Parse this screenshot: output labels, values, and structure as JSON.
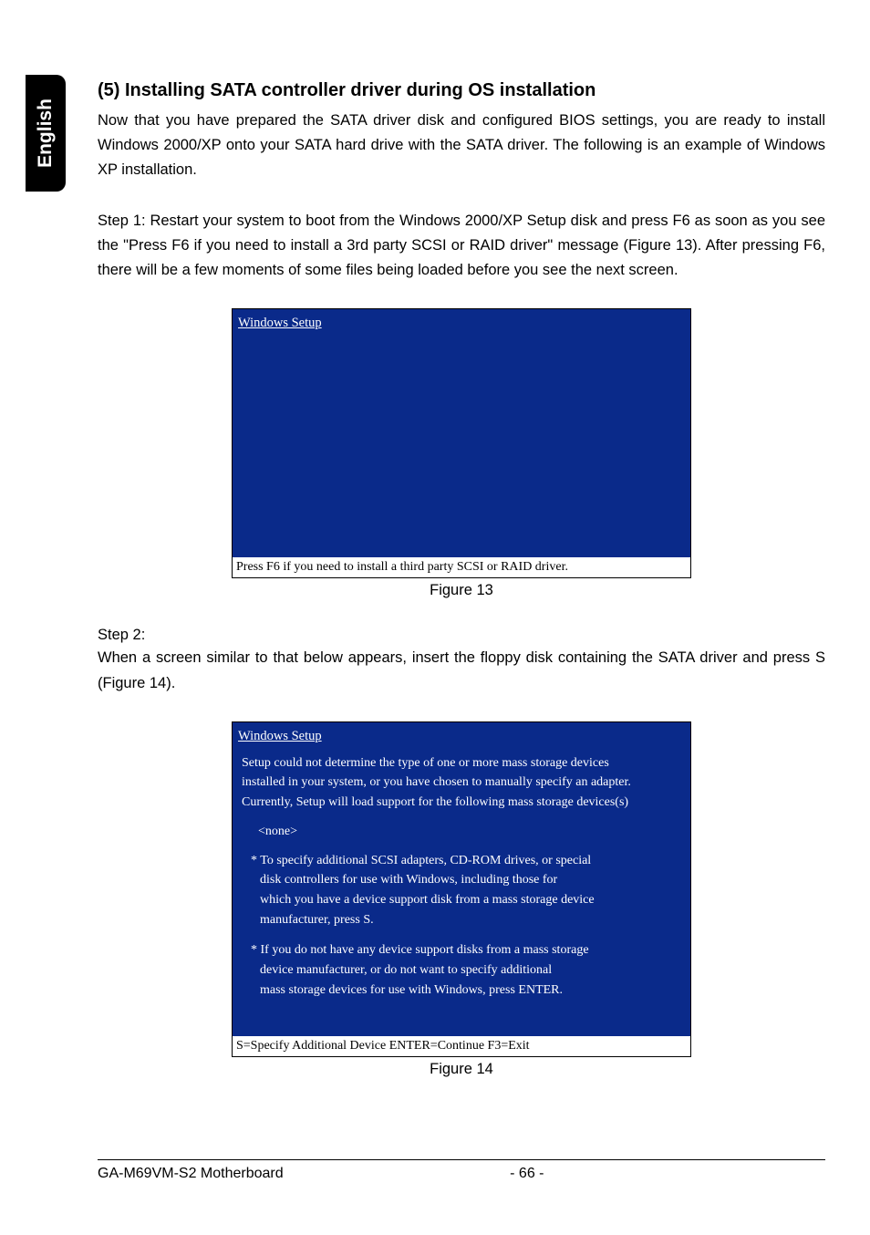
{
  "side_tab": "English",
  "heading": "(5) Installing SATA controller driver during OS installation",
  "para1": "Now that you have prepared the SATA driver disk and configured BIOS settings, you are ready to install Windows 2000/XP onto your SATA hard drive with the SATA driver. The following is an example of Windows XP installation.",
  "para2": "Step 1: Restart your system to boot from the Windows 2000/XP Setup disk and press F6 as soon as you see the \"Press F6 if you need to install a 3rd party SCSI or RAID driver\" message (Figure 13).  After pressing F6, there will be a few moments of some files being loaded before you see the next screen.",
  "fig13": {
    "title": "Windows Setup",
    "footer": "Press F6 if you need to install a third party SCSI or RAID driver.",
    "caption": "Figure 13"
  },
  "step2_label": "Step 2:",
  "step2_text": "When a screen similar to that below appears, insert the floppy disk containing the SATA driver and press S (Figure 14).",
  "fig14": {
    "title": "Windows Setup",
    "line1": "Setup could not determine the type of one or more mass storage devices",
    "line2": "installed in your system, or you have chosen to manually specify an adapter.",
    "line3": "Currently, Setup will load support for the following mass storage devices(s)",
    "none": "<none>",
    "b1_l1": "* To specify additional SCSI adapters, CD-ROM drives, or special",
    "b1_l2": "disk  controllers for use with Windows, including those for",
    "b1_l3": "which you have a device support disk from a mass storage device",
    "b1_l4": "manufacturer, press S.",
    "b2_l1": "* If you do not have any device support disks from a mass storage",
    "b2_l2": "device manufacturer, or do not want to specify additional",
    "b2_l3": "mass storage devices for use with Windows, press ENTER.",
    "footer": "S=Specify Additional Device   ENTER=Continue   F3=Exit",
    "caption": "Figure 14"
  },
  "footer": {
    "left": "GA-M69VM-S2 Motherboard",
    "center": "- 66 -"
  }
}
